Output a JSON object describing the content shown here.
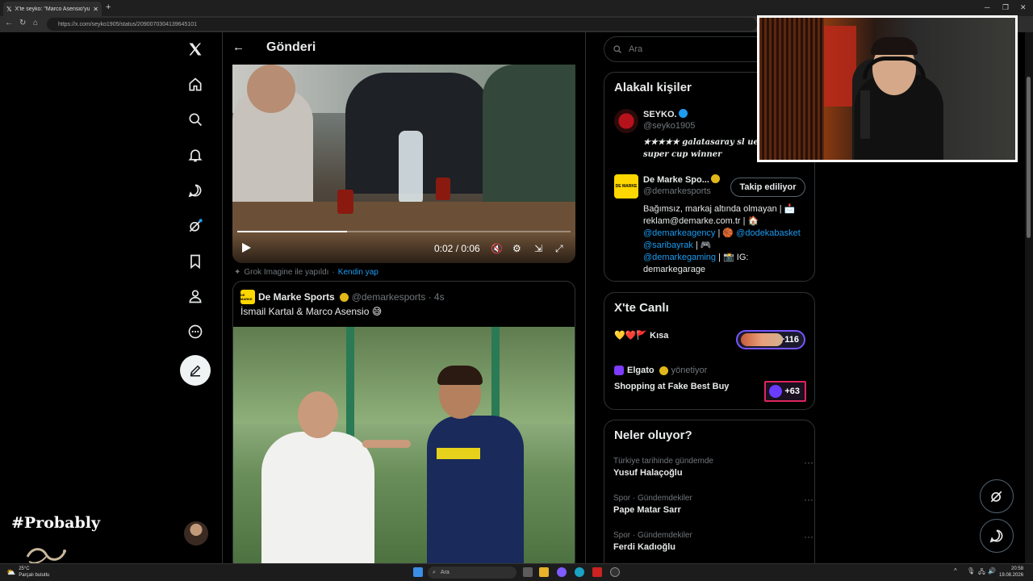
{
  "browser": {
    "tab_title": "X'te seyko: \"Marco Asensio'yu oy...",
    "new_tab": "+",
    "url": "https://x.com/seyko1905/status/2090070304139645101",
    "win_min": "─",
    "win_max": "❐",
    "win_close": "✕"
  },
  "header": {
    "back": "←",
    "title": "Gönderi"
  },
  "video": {
    "time": "0:02 / 0:06",
    "progress": 0.33
  },
  "grok": {
    "made_with": "Grok Imagine ile yapıldı",
    "action": "Kendin yap"
  },
  "quote": {
    "logo_text": "DE MARKE",
    "name": "De Marke Sports",
    "handle": "@demarkesports · 4s",
    "text": "İsmail Kartal & Marco Asensio 😅"
  },
  "search": {
    "placeholder": "Ara"
  },
  "related": {
    "title": "Alakalı kişiler",
    "people": [
      {
        "name": "SEYKO.",
        "handle": "@seyko1905",
        "bio": "★★★★★ 𝖌𝖆𝖑𝖆𝖙𝖆𝖘𝖆𝖗𝖆𝖞 𝖘𝖑 𝖚𝖊𝖋𝖆 𝖈𝖚𝖕 𝖜𝖎𝖓𝖓𝖊𝖗 𝖘𝖚𝖕𝖊𝖗 𝖈𝖚𝖕 𝖜𝖎𝖓𝖓𝖊𝖗",
        "bio_line1": "★★★★★ galatasaray sl uefa",
        "bio_line2": "super cup winner"
      },
      {
        "name": "De Marke Spo...",
        "handle": "@demarkesports",
        "follow_label": "Takip ediliyor",
        "bio_l1": "Bağımsız, markaj altında olmayan | 📩",
        "bio_l2": "reklam@demarke.com.tr | 🏠",
        "bio_l3a": "@demarkeagency",
        "bio_l3b": " | 🏀 ",
        "bio_l3c": "@dodekabasket",
        "bio_l4a": " | 🚗 ",
        "bio_l4b": "@saribayrak",
        "bio_l4c": " | 🎮",
        "bio_l5a": "@demarkegaming",
        "bio_l5b": " | 📸 IG:",
        "bio_l6": "demarkegarage"
      }
    ]
  },
  "live": {
    "title": "X'te Canlı",
    "items": [
      {
        "title": "💛❤️🚩 Kısa",
        "count": "+116"
      },
      {
        "host": "Elgato",
        "role": "yönetiyor",
        "title": "Shopping at Fake Best Buy",
        "count": "+63"
      }
    ]
  },
  "trends": {
    "title": "Neler oluyor?",
    "items": [
      {
        "meta": "Türkiye tarihinde gündemde",
        "title": "Yusuf Halaçoğlu"
      },
      {
        "meta": "Spor · Gündemdekiler",
        "title": "Pape Matar Sarr"
      },
      {
        "meta": "Spor · Gündemdekiler",
        "title": "Ferdi Kadıoğlu"
      }
    ],
    "more": "···"
  },
  "overlay": {
    "hashtag": "#Probably"
  },
  "taskbar": {
    "temp": "25°C",
    "weather": "Parçalı bulutlu",
    "search": "Ara",
    "time": "20:58",
    "date": "19.08.2026"
  },
  "colors": {
    "accent": "#1d9bf0",
    "bg": "#000000",
    "border": "#2f3336",
    "muted": "#71767b"
  }
}
